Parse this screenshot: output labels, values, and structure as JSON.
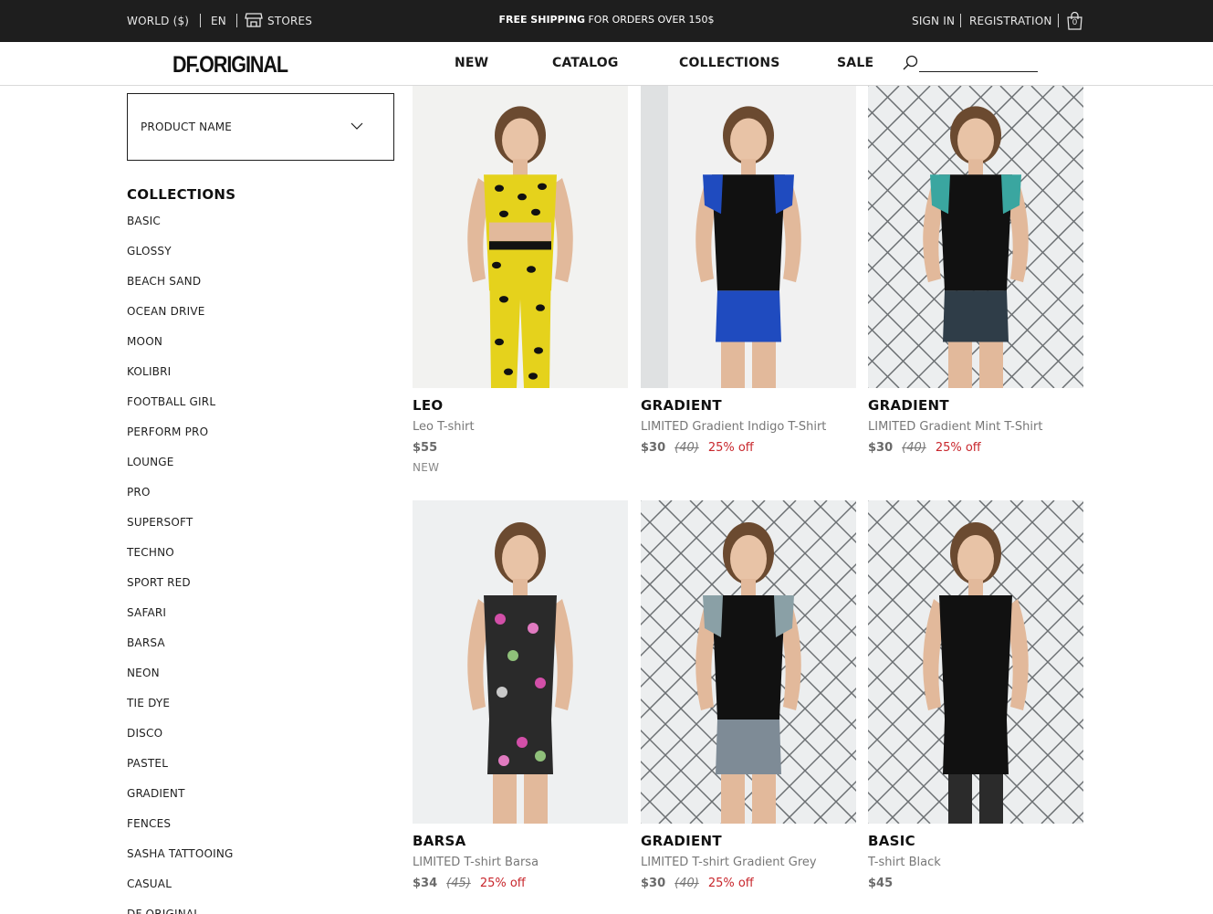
{
  "topbar": {
    "region": "WORLD ($)",
    "language": "EN",
    "stores": "STORES",
    "shipping_bold": "FREE SHIPPING",
    "shipping_rest": "FOR ORDERS OVER 150$",
    "sign_in": "SIGN IN",
    "registration": "REGISTRATION",
    "cart_count": "0"
  },
  "nav": {
    "logo": "DF.ORIGINAL",
    "items": [
      "NEW",
      "CATALOG",
      "COLLECTIONS",
      "SALE"
    ],
    "search_placeholder": ""
  },
  "sidebar": {
    "sort_label": "PRODUCT NAME",
    "collections_title": "COLLECTIONS",
    "collections": [
      "BASIC",
      "GLOSSY",
      "BEACH SAND",
      "OCEAN DRIVE",
      "MOON",
      "KOLIBRI",
      "FOOTBALL GIRL",
      "PERFORM PRO",
      "LOUNGE",
      "PRO",
      "SUPERSOFT",
      "TECHNO",
      "SPORT RED",
      "SAFARI",
      "BARSA",
      "NEON",
      "TIE DYE",
      "DISCO",
      "PASTEL",
      "GRADIENT",
      "FENCES",
      "SASHA TATTOOING",
      "CASUAL",
      "DF ORIGINAL"
    ]
  },
  "products": [
    {
      "brand": "LEO",
      "name": "Leo T-shirt",
      "price": "$55",
      "old_price": "",
      "discount": "",
      "badge": "NEW",
      "photo": "leo"
    },
    {
      "brand": "GRADIENT",
      "name": "LIMITED Gradient Indigo T-Shirt",
      "price": "$30",
      "old_price": "(40)",
      "discount": "25% off",
      "badge": "",
      "photo": "indigo"
    },
    {
      "brand": "GRADIENT",
      "name": "LIMITED Gradient Mint T-Shirt",
      "price": "$30",
      "old_price": "(40)",
      "discount": "25% off",
      "badge": "",
      "photo": "mint"
    },
    {
      "brand": "BARSA",
      "name": "LIMITED T-shirt Barsa",
      "price": "$34",
      "old_price": "(45)",
      "discount": "25% off",
      "badge": "",
      "photo": "barsa"
    },
    {
      "brand": "GRADIENT",
      "name": "LIMITED T-shirt Gradient Grey",
      "price": "$30",
      "old_price": "(40)",
      "discount": "25% off",
      "badge": "",
      "photo": "grey"
    },
    {
      "brand": "BASIC",
      "name": "T-shirt Black",
      "price": "$45",
      "old_price": "",
      "discount": "",
      "badge": "",
      "photo": "black"
    }
  ],
  "colors": {
    "topbar_bg": "#1e1e1e",
    "discount": "#c8262c",
    "text_muted": "#777777"
  }
}
